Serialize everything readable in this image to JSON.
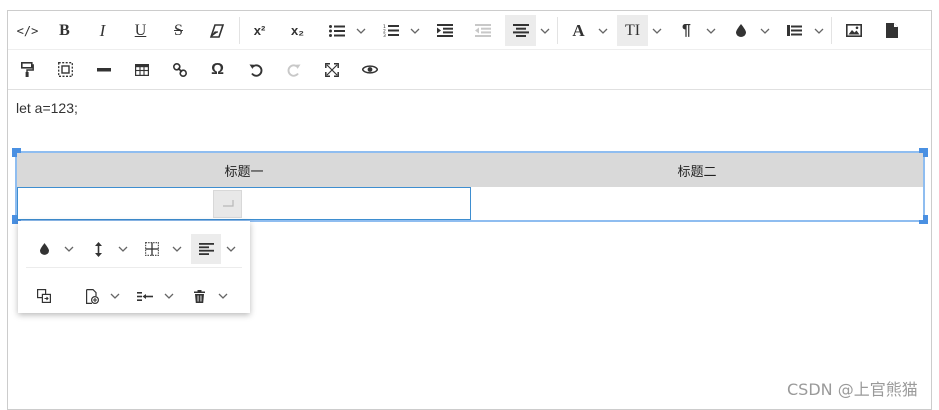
{
  "toolbar": {
    "row1": [
      {
        "name": "code-icon",
        "glyph": "</>"
      },
      {
        "name": "bold-icon",
        "glyph": "B"
      },
      {
        "name": "italic-icon",
        "glyph": "I"
      },
      {
        "name": "underline-icon",
        "glyph": "U"
      },
      {
        "name": "strikethrough-icon",
        "glyph": "S"
      },
      {
        "name": "clear-format-icon",
        "glyph": ""
      },
      {
        "name": "superscript-icon",
        "glyph": "x²"
      },
      {
        "name": "subscript-icon",
        "glyph": "x₂"
      },
      {
        "name": "bulleted-list-icon",
        "glyph": ""
      },
      {
        "name": "numbered-list-icon",
        "glyph": ""
      },
      {
        "name": "indent-icon",
        "glyph": ""
      },
      {
        "name": "outdent-icon",
        "glyph": ""
      },
      {
        "name": "align-center-icon",
        "glyph": ""
      },
      {
        "name": "font-color-icon",
        "glyph": "A"
      },
      {
        "name": "font-size-icon",
        "glyph": "TI"
      },
      {
        "name": "paragraph-icon",
        "glyph": "¶"
      },
      {
        "name": "background-color-icon",
        "glyph": ""
      },
      {
        "name": "block-style-icon",
        "glyph": ""
      },
      {
        "name": "image-icon",
        "glyph": ""
      },
      {
        "name": "file-icon",
        "glyph": ""
      }
    ],
    "row2": [
      {
        "name": "format-painter-icon",
        "glyph": ""
      },
      {
        "name": "select-all-icon",
        "glyph": ""
      },
      {
        "name": "horizontal-rule-icon",
        "glyph": ""
      },
      {
        "name": "table-icon",
        "glyph": ""
      },
      {
        "name": "link-icon",
        "glyph": ""
      },
      {
        "name": "special-char-icon",
        "glyph": "Ω"
      },
      {
        "name": "undo-icon",
        "glyph": ""
      },
      {
        "name": "redo-icon",
        "glyph": ""
      },
      {
        "name": "fullscreen-icon",
        "glyph": ""
      },
      {
        "name": "preview-icon",
        "glyph": ""
      }
    ]
  },
  "content": {
    "paragraph": "let a=123;",
    "table": {
      "headers": [
        "标题一",
        "标题二"
      ],
      "rows": [
        [
          "",
          ""
        ]
      ]
    }
  },
  "table_popup": {
    "row1": [
      "cell-color-icon",
      "row-height-icon",
      "cell-border-icon",
      "cell-align-icon"
    ],
    "row2": [
      "merge-cells-icon",
      "insert-cell-icon",
      "split-cells-icon",
      "delete-icon"
    ]
  },
  "colors": {
    "accent": "#4a90e2",
    "header_bg": "#d9d9d9",
    "active_bg": "#ececec"
  },
  "watermark": "CSDN @上官熊猫"
}
